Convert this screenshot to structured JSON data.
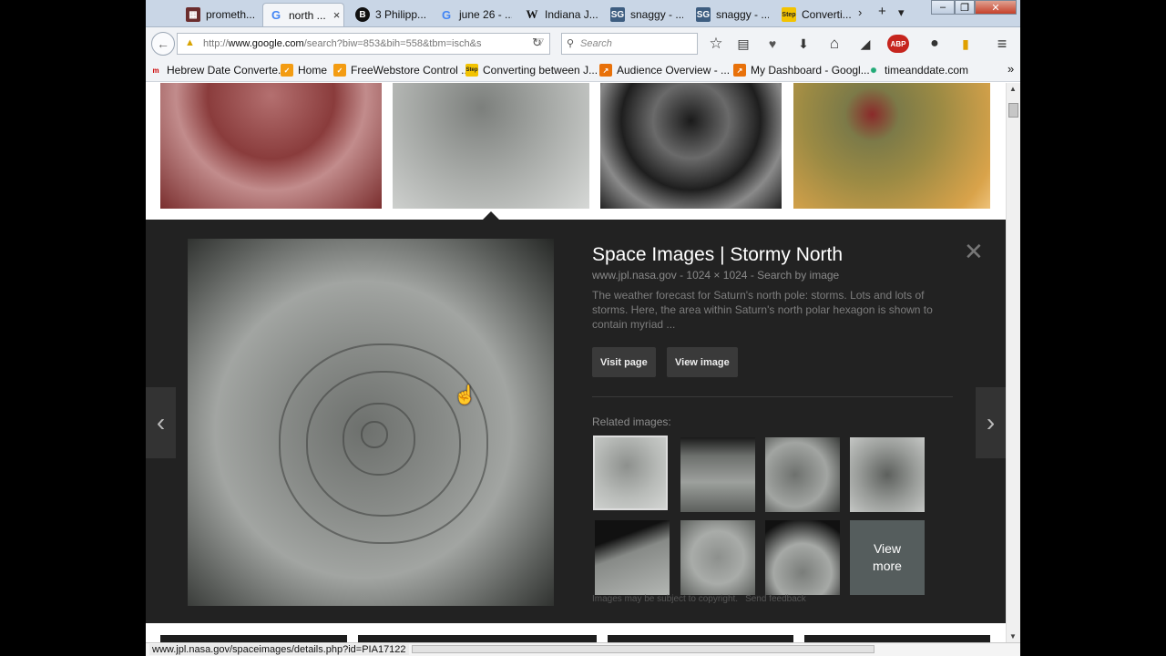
{
  "browser": {
    "tabs": [
      {
        "label": "prometh...",
        "icon": "flag-favicon"
      },
      {
        "label": "north ...",
        "icon": "google-favicon",
        "active": true
      },
      {
        "label": "3 Philipp...",
        "icon": "b-favicon"
      },
      {
        "label": "june 26 - ...",
        "icon": "google-favicon"
      },
      {
        "label": "Indiana J...",
        "icon": "wikipedia-favicon"
      },
      {
        "label": "snaggy - ...",
        "icon": "sg-favicon"
      },
      {
        "label": "snaggy - ...",
        "icon": "sg-favicon"
      },
      {
        "label": "Converti...",
        "icon": "step-favicon"
      }
    ],
    "tab_close": "×",
    "scroll_right": "›",
    "new_tab": "+",
    "tab_list": "▾",
    "window_buttons": {
      "minimize": "‒",
      "maximize": "❐",
      "close": "✕"
    }
  },
  "navbar": {
    "back": "←",
    "url_prefix": "http://",
    "url_host": "www.google.com",
    "url_rest": "/search?biw=853&bih=558&tbm=isch&s",
    "warn": "▲",
    "dropdown": "▽",
    "reload": "↻",
    "search_placeholder": "Search",
    "search_glyph": "⚲",
    "toolbar": {
      "star": "☆",
      "reader": "▤",
      "pocket": "♥",
      "download": "⬇",
      "home": "⌂",
      "send": "◢",
      "abp": "ABP",
      "chat": "●",
      "bookmark": "▮",
      "menu": "≡"
    }
  },
  "bookmarks": [
    {
      "label": "Hebrew Date Converte...",
      "icon": "hebcal-favicon"
    },
    {
      "label": "Home",
      "icon": "freewebstore-favicon"
    },
    {
      "label": "FreeWebstore Control ...",
      "icon": "freewebstore-favicon"
    },
    {
      "label": "Converting between J...",
      "icon": "step-favicon"
    },
    {
      "label": "Audience Overview - ...",
      "icon": "analytics-favicon"
    },
    {
      "label": "My Dashboard - Googl...",
      "icon": "analytics-favicon"
    },
    {
      "label": "timeanddate.com",
      "icon": "timeanddate-favicon"
    }
  ],
  "bookmarks_more": "»",
  "panel": {
    "title": "Space Images | Stormy North",
    "source": "www.jpl.nasa.gov",
    "dimensions": "1024 × 1024",
    "search_by_image": "Search by image",
    "meta_sep": "-",
    "description": "The weather forecast for Saturn's north pole: storms. Lots and lots of storms. Here, the area within Saturn's north polar hexagon is shown to contain myriad ...",
    "visit_page": "Visit page",
    "view_image": "View image",
    "related_label": "Related images:",
    "view_more": "View more",
    "copyright": "Images may be subject to copyright.",
    "feedback": "Send feedback",
    "close": "✕",
    "prev": "‹",
    "next": "›"
  },
  "status_bar": {
    "text": "www.jpl.nasa.gov/spaceimages/details.php?id=PIA17122"
  },
  "colors": {
    "panel_bg": "#222222",
    "tab_bg": "#c9d6e6",
    "toolbar_bg": "#f1f3f6"
  }
}
